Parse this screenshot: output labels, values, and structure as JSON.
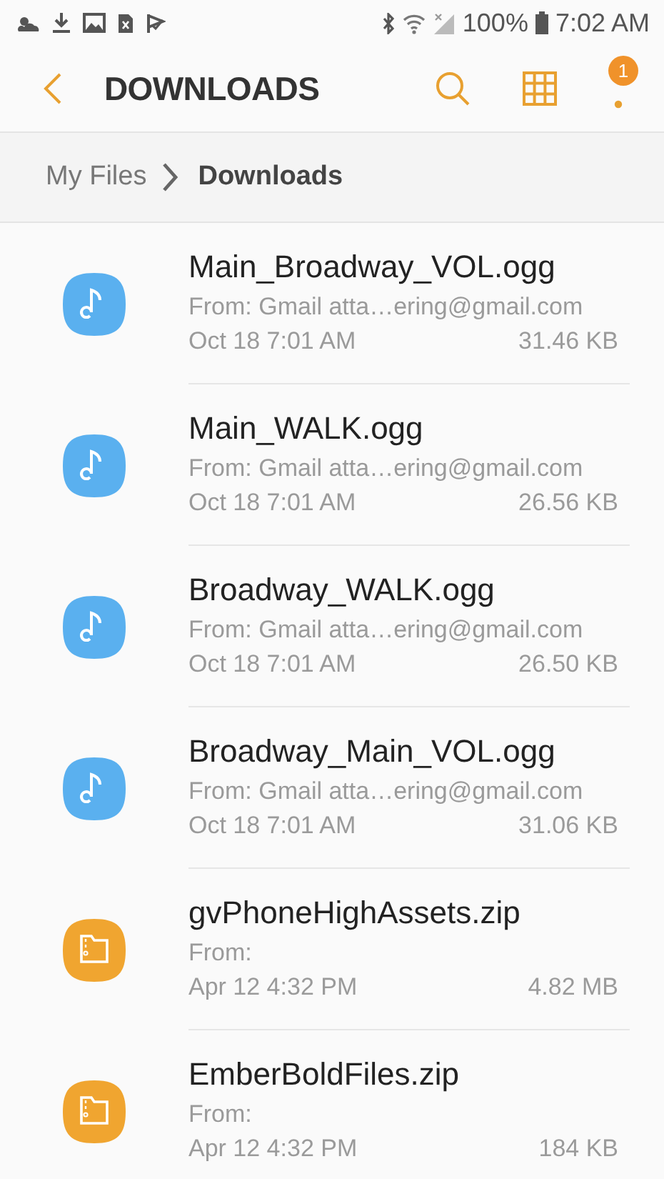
{
  "status_bar": {
    "battery": "100%",
    "time": "7:02 AM"
  },
  "app_bar": {
    "title": "DOWNLOADS",
    "notification_badge": "1"
  },
  "breadcrumb": [
    {
      "label": "My Files",
      "selected": false
    },
    {
      "label": "Downloads",
      "selected": true
    }
  ],
  "files": [
    {
      "kind": "audio",
      "name": "Main_Broadway_VOL.ogg",
      "source": "From: Gmail atta…ering@gmail.com",
      "date": "Oct 18 7:01 AM",
      "size": "31.46 KB"
    },
    {
      "kind": "audio",
      "name": "Main_WALK.ogg",
      "source": "From: Gmail atta…ering@gmail.com",
      "date": "Oct 18 7:01 AM",
      "size": "26.56 KB"
    },
    {
      "kind": "audio",
      "name": "Broadway_WALK.ogg",
      "source": "From: Gmail atta…ering@gmail.com",
      "date": "Oct 18 7:01 AM",
      "size": "26.50 KB"
    },
    {
      "kind": "audio",
      "name": "Broadway_Main_VOL.ogg",
      "source": "From: Gmail atta…ering@gmail.com",
      "date": "Oct 18 7:01 AM",
      "size": "31.06 KB"
    },
    {
      "kind": "archive",
      "name": "gvPhoneHighAssets.zip",
      "source": "From:",
      "date": "Apr 12 4:32 PM",
      "size": "4.82 MB"
    },
    {
      "kind": "archive",
      "name": "EmberBoldFiles.zip",
      "source": "From:",
      "date": "Apr 12 4:32 PM",
      "size": "184 KB"
    }
  ]
}
